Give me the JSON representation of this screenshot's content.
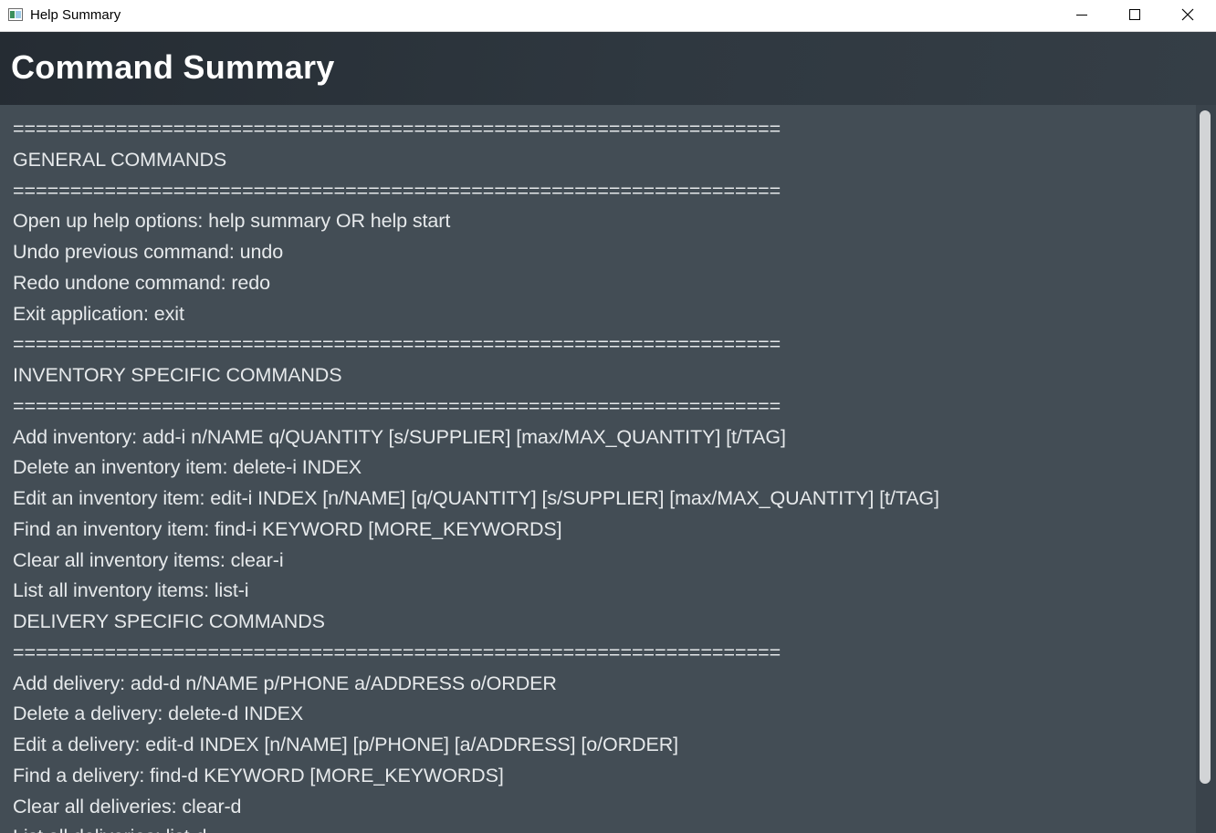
{
  "window": {
    "title": "Help Summary",
    "icons": [
      "app-icon",
      "minimize-icon",
      "maximize-icon",
      "close-icon"
    ]
  },
  "header": {
    "title": "Command Summary"
  },
  "content": {
    "lines": [
      "===================================================================",
      "GENERAL COMMANDS",
      "===================================================================",
      "Open up help options: help summary OR help start",
      "Undo previous command: undo",
      "Redo undone command: redo",
      "Exit application: exit",
      "===================================================================",
      "INVENTORY SPECIFIC COMMANDS",
      "===================================================================",
      "Add inventory: add-i n/NAME q/QUANTITY [s/SUPPLIER] [max/MAX_QUANTITY] [t/TAG]",
      "Delete an inventory item: delete-i INDEX",
      "Edit an inventory item: edit-i INDEX [n/NAME] [q/QUANTITY] [s/SUPPLIER] [max/MAX_QUANTITY] [t/TAG]",
      "Find an inventory item: find-i KEYWORD [MORE_KEYWORDS]",
      "Clear all inventory items: clear-i",
      "List all inventory items: list-i",
      "DELIVERY SPECIFIC COMMANDS",
      "===================================================================",
      "Add delivery: add-d n/NAME p/PHONE a/ADDRESS o/ORDER",
      "Delete a delivery: delete-d INDEX",
      "Edit a delivery: edit-d INDEX [n/NAME] [p/PHONE] [a/ADDRESS] [o/ORDER]",
      "Find a delivery: find-d KEYWORD [MORE_KEYWORDS]",
      "Clear all deliveries: clear-d",
      "List all deliveries: list-d"
    ]
  },
  "colors": {
    "header_bg": "#2f3840",
    "content_bg": "#434d55",
    "text": "#e6e9eb"
  }
}
